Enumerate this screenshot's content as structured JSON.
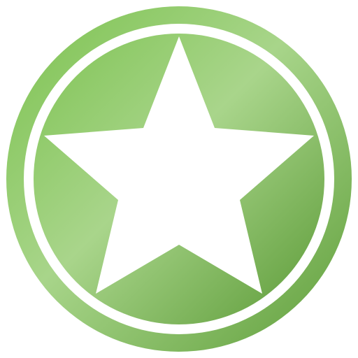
{
  "icon": {
    "name": "star-badge-icon",
    "colors": {
      "outer_ring_light": "#7cc24f",
      "outer_ring_mid": "#a8d58a",
      "outer_ring_dark": "#5f9e3a",
      "disc_light": "#80c455",
      "disc_mid": "#a9d58b",
      "disc_dark": "#5b9a36",
      "inner_ring": "#ffffff",
      "star": "#ffffff",
      "background": "#ffffff"
    }
  }
}
